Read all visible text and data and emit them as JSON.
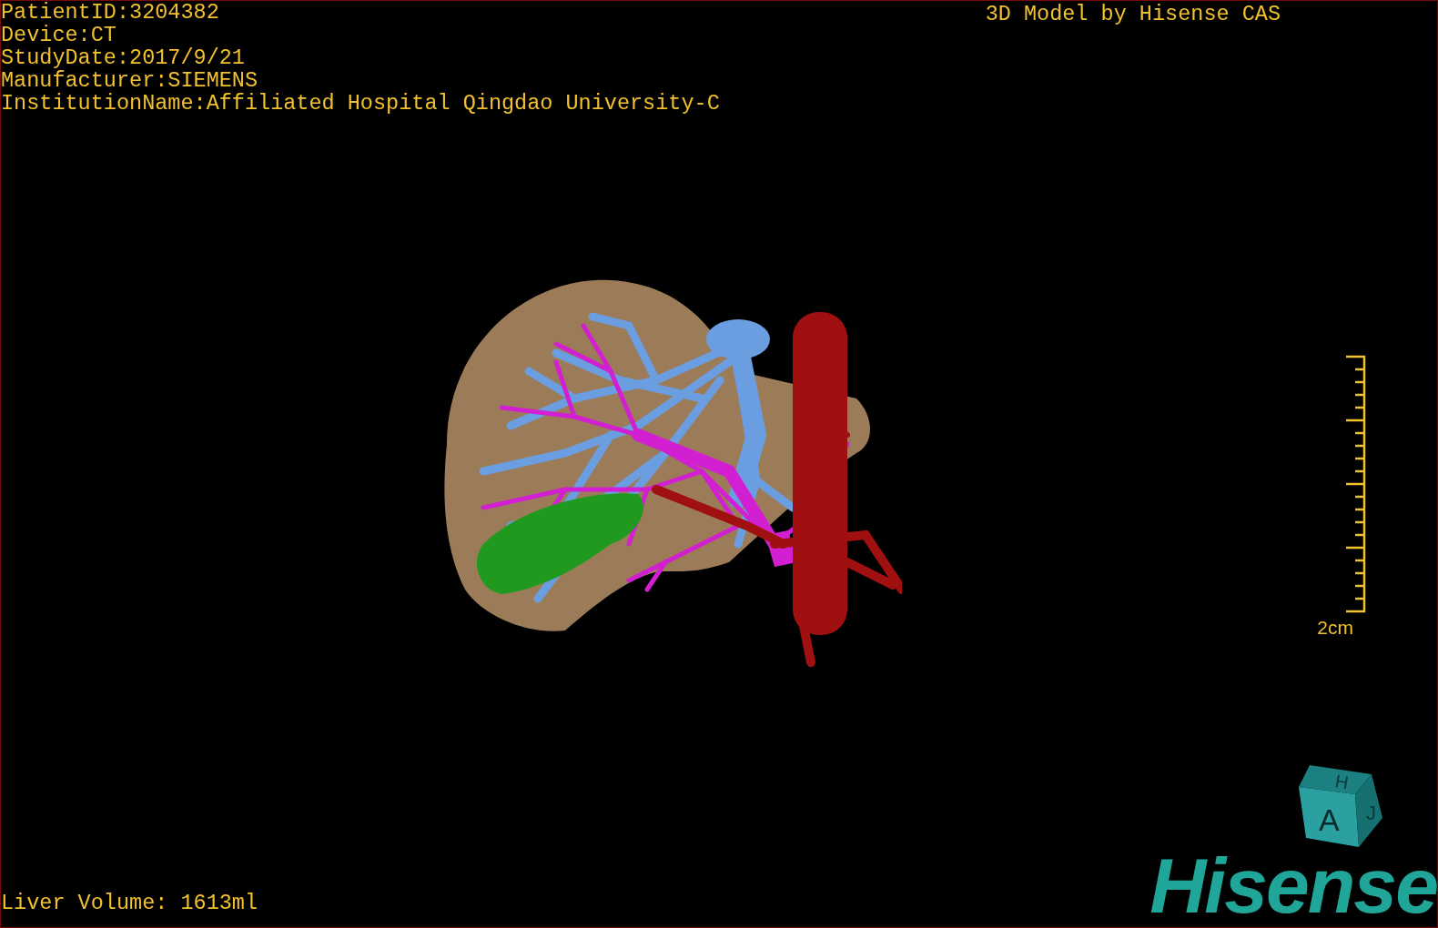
{
  "header": {
    "patient_info": [
      "PatientID:3204382",
      "Device:CT",
      "StudyDate:2017/9/21",
      "Manufacturer:SIEMENS",
      "InstitutionName:Affiliated Hospital Qingdao University-C"
    ],
    "title": "3D Model by Hisense CAS"
  },
  "scale_bar": {
    "label": "2cm"
  },
  "footer": {
    "liver_volume": "Liver Volume: 1613ml"
  },
  "orientation_cube": {
    "top": "H",
    "front": "A",
    "side": "J"
  },
  "logo": "Hisense"
}
